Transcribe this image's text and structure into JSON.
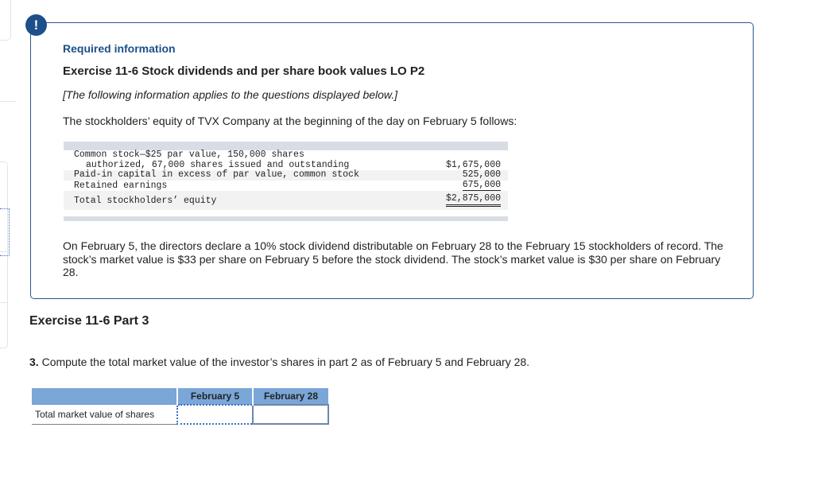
{
  "alert_icon": "exclamation-icon",
  "required_info": {
    "heading": "Required information",
    "exercise_title": "Exercise 11-6 Stock dividends and per share book values LO P2",
    "note": "[The following information applies to the questions displayed below.]",
    "intro": "The stockholders’ equity of TVX Company at the beginning of the day on February 5 follows:",
    "ledger": {
      "rows": [
        {
          "label_line1": "Common stock—$25 par value, 150,000 shares",
          "label_line2": "authorized, 67,000 shares issued and outstanding",
          "amount": "$1,675,000"
        },
        {
          "label": "Paid-in capital in excess of par value, common stock",
          "amount": "525,000"
        },
        {
          "label": "Retained earnings",
          "amount": "675,000"
        },
        {
          "label": "Total stockholders’ equity",
          "amount": "$2,875,000"
        }
      ]
    },
    "paragraph": "On February 5, the directors declare a 10% stock dividend distributable on February 28 to the February 15 stockholders of record. The stock’s market value is $33 per share on February 5 before the stock dividend. The stock’s market value is $30 per share on February 28."
  },
  "part": {
    "title": "Exercise 11-6 Part 3",
    "question_number": "3.",
    "question": "Compute the total market value of the investor’s shares in part 2 as of February 5 and February 28."
  },
  "answer_table": {
    "columns": [
      "",
      "February 5",
      "February 28"
    ],
    "rows": [
      {
        "label": "Total market value of shares",
        "february_5": "",
        "february_28": ""
      }
    ]
  },
  "colors": {
    "accent": "#1d4f8a",
    "table_header": "#7aa6d8",
    "ledger_bar": "#d8dde5"
  }
}
